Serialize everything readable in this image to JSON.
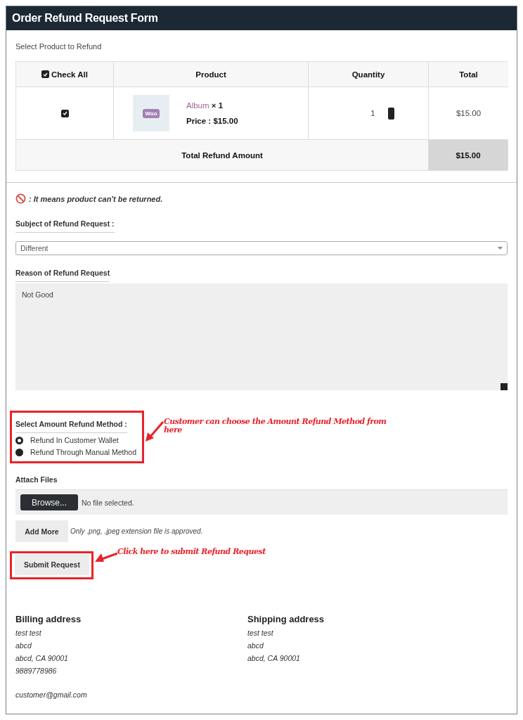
{
  "window": {
    "title": "Order Refund Request Form"
  },
  "product_section": {
    "label": "Select Product to Refund",
    "columns": [
      {
        "kind": "check_all",
        "label": "Check All",
        "checked": true
      },
      {
        "kind": "text",
        "label": "Product"
      },
      {
        "kind": "text",
        "label": "Quantity"
      },
      {
        "kind": "text",
        "label": "Total"
      }
    ],
    "rows": [
      {
        "checked": true,
        "thumbnail": "Woo",
        "product_name": "Album",
        "quantity_mark": "× 1",
        "price_label": "Price :",
        "price": "$15.00",
        "quantity": "1",
        "total": "$15.00"
      }
    ],
    "total_row": {
      "label": "Total Refund Amount",
      "value": "$15.00"
    }
  },
  "notice": ": It means product can't be returned.",
  "subject": {
    "label": "Subject of Refund Request :",
    "value": "Different"
  },
  "reason": {
    "label": "Reason of Refund Request",
    "value": "Not Good"
  },
  "refund_method": {
    "label": "Select Amount Refund Method :",
    "options": [
      {
        "label": "Refund In Customer Wallet",
        "selected": true
      },
      {
        "label": "Refund Through Manual Method",
        "selected": false
      }
    ]
  },
  "attach": {
    "label": "Attach Files",
    "browse_button": "Browse...",
    "file_status": "No file selected.",
    "add_more_button": "Add More",
    "hint": "Only .png, .jpeg extension file is approved."
  },
  "submit_button": "Submit Request",
  "annotations": [
    {
      "kind": "method",
      "text": "Customer can choose the Amount Refund Method from here"
    },
    {
      "kind": "submit",
      "text": "Click here to submit Refund Request"
    }
  ],
  "billing": {
    "title": "Billing address",
    "lines": [
      "test test",
      "abcd",
      "abcd, CA 90001",
      "9889778986"
    ],
    "email": "customer@gmail.com"
  },
  "shipping": {
    "title": "Shipping address",
    "lines": [
      "test test",
      "abcd",
      "abcd, CA 90001"
    ]
  }
}
